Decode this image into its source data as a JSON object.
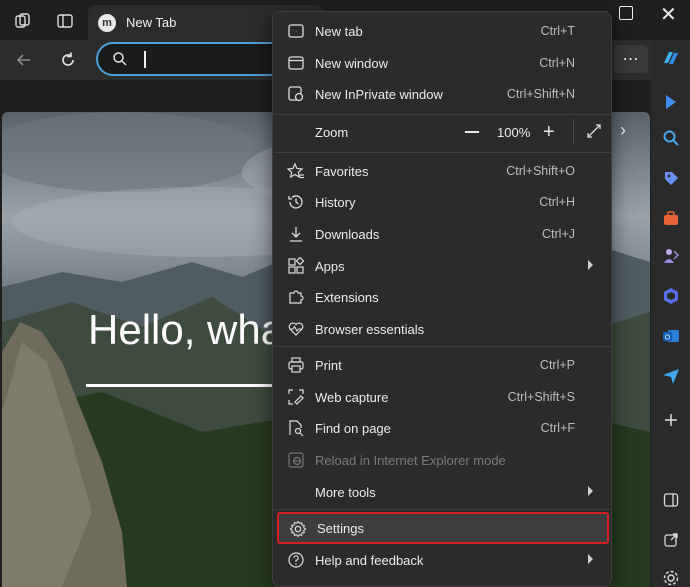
{
  "browser": {
    "tab_title": "New Tab",
    "tab_favicon_letter": "m",
    "address_value": ""
  },
  "page": {
    "greeting": "Hello, wha"
  },
  "menu": {
    "items": [
      {
        "label": "New tab",
        "shortcut": "Ctrl+T",
        "icon": "new-tab-icon"
      },
      {
        "label": "New window",
        "shortcut": "Ctrl+N",
        "icon": "new-window-icon"
      },
      {
        "label": "New InPrivate window",
        "shortcut": "Ctrl+Shift+N",
        "icon": "inprivate-icon"
      },
      {
        "label": "Zoom",
        "icon": "none"
      },
      {
        "label": "Favorites",
        "shortcut": "Ctrl+Shift+O",
        "icon": "favorites-icon"
      },
      {
        "label": "History",
        "shortcut": "Ctrl+H",
        "icon": "history-icon"
      },
      {
        "label": "Downloads",
        "shortcut": "Ctrl+J",
        "icon": "downloads-icon"
      },
      {
        "label": "Apps",
        "icon": "apps-icon",
        "submenu": true
      },
      {
        "label": "Extensions",
        "icon": "extensions-icon"
      },
      {
        "label": "Browser essentials",
        "icon": "heart-pulse-icon"
      },
      {
        "label": "Print",
        "shortcut": "Ctrl+P",
        "icon": "print-icon"
      },
      {
        "label": "Web capture",
        "shortcut": "Ctrl+Shift+S",
        "icon": "web-capture-icon"
      },
      {
        "label": "Find on page",
        "shortcut": "Ctrl+F",
        "icon": "find-icon"
      },
      {
        "label": "Reload in Internet Explorer mode",
        "icon": "ie-mode-icon",
        "disabled": true
      },
      {
        "label": "More tools",
        "icon": "none",
        "submenu": true
      },
      {
        "label": "Settings",
        "icon": "gear-icon",
        "highlighted": true
      },
      {
        "label": "Help and feedback",
        "icon": "help-icon",
        "submenu": true
      }
    ],
    "zoom_value": "100%"
  },
  "colors": {
    "menu_bg": "#2b2b2b",
    "highlight_border": "#d62020",
    "address_border": "#4d9fd8"
  }
}
